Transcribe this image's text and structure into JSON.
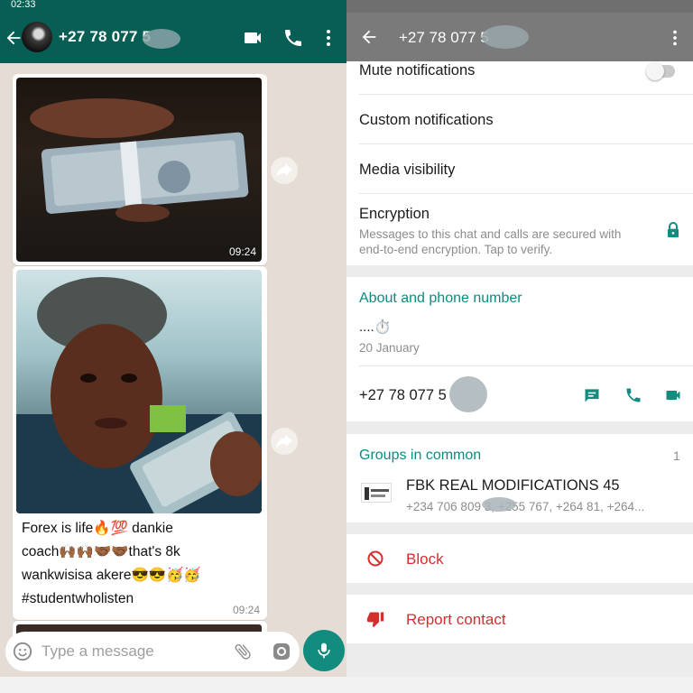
{
  "status_bar": {
    "time": "02:33"
  },
  "chat": {
    "contact_title": "+27 78 077 5",
    "messages": [
      {
        "type": "image",
        "description_icon": "money-photo",
        "time": "09:24"
      },
      {
        "type": "image_caption",
        "time": "09:24",
        "caption_lines": [
          "Forex is life🔥💯 dankie",
          "coach🙌🏾🙌🏾🤝🏾🤝🏾that's 8k",
          "wankwisisa akere😎😎🥳🥳",
          "#studentwholisten"
        ]
      }
    ],
    "input": {
      "placeholder": "Type a message"
    }
  },
  "contact_info": {
    "title": "+27 78 077 5",
    "mute_label": "Mute notifications",
    "mute_enabled": false,
    "custom_notifications_label": "Custom notifications",
    "media_visibility_label": "Media visibility",
    "encryption": {
      "label": "Encryption",
      "description_line1": "Messages to this chat and calls are secured with",
      "description_line2": "end-to-end encryption. Tap to verify."
    },
    "about": {
      "heading": "About and phone number",
      "status": "....⏱️",
      "date": "20 January",
      "phone": "+27 78 077 5"
    },
    "groups": {
      "heading": "Groups in common",
      "count": "1",
      "items": [
        {
          "name": "FBK REAL MODIFICATIONS 45",
          "members": "+234 706 809     3, +255 767, +264 81, +264..."
        }
      ]
    },
    "block_label": "Block",
    "report_label": "Report contact"
  },
  "colors": {
    "whatsapp_header": "#075e54",
    "teal_accent": "#0b8c80",
    "fab_green": "#128c7e",
    "danger_red": "#d32f2f",
    "chat_background": "#e5ddd5"
  }
}
